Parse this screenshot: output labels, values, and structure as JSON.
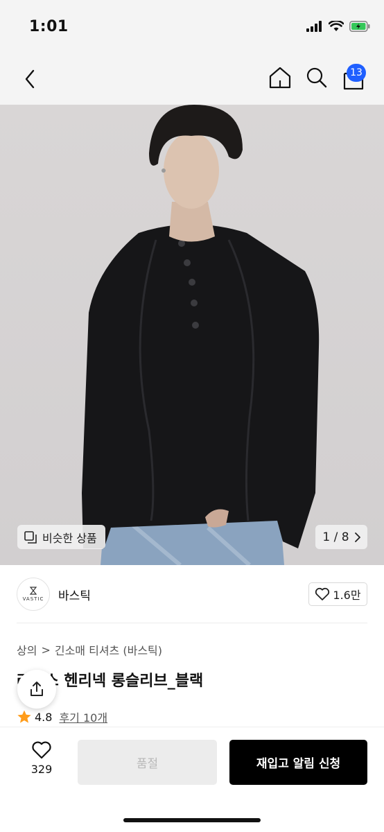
{
  "status_bar": {
    "time": "1:01"
  },
  "cart": {
    "badge_count": "13"
  },
  "gallery": {
    "similar_label": "비슷한 상품",
    "counter": "1 / 8"
  },
  "brand": {
    "name": "바스틱",
    "logo_text": "VASTIC",
    "like_count": "1.6만"
  },
  "breadcrumb": {
    "category": "상의",
    "separator": ">",
    "subcategory": "긴소매 티셔츠 (바스틱)"
  },
  "product": {
    "title": "라이스 헨리넥 롱슬리브_블랙",
    "rating": "4.8",
    "review_label": "후기 10개"
  },
  "bottom_bar": {
    "wish_count": "329",
    "soldout_label": "품절",
    "restock_label": "재입고 알림 신청"
  },
  "colors": {
    "accent": "#1f5fff",
    "star": "#ff9c1a",
    "primary_button": "#000000"
  }
}
